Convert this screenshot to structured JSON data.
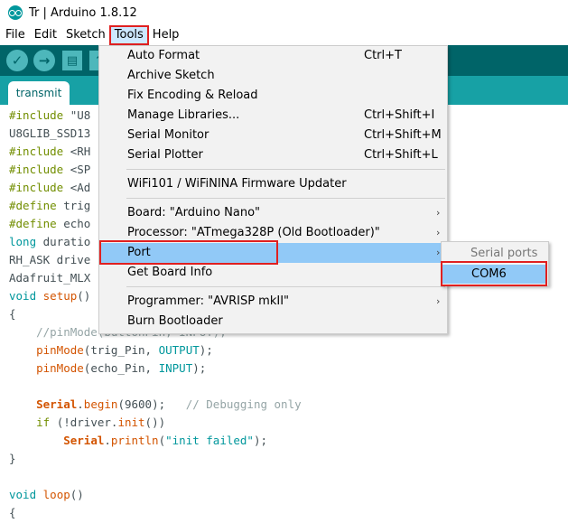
{
  "window": {
    "title": "Tr | Arduino 1.8.12"
  },
  "menubar": {
    "items": [
      "File",
      "Edit",
      "Sketch",
      "Tools",
      "Help"
    ]
  },
  "toolbar": {
    "verify": "✓",
    "upload": "→",
    "new": "▤",
    "open": "↑"
  },
  "tab": {
    "label": "transmit"
  },
  "code": {
    "lines": [
      "#include \"U8",
      "U8GLIB_SSD13",
      "#include <RH",
      "#include <SP",
      "#include <Ad",
      "#define trig",
      "#define echo",
      "long duratio",
      "RH_ASK drive",
      "Adafruit_MLX",
      "void setup()",
      "{",
      "    //pinMode(buttonPin, INPUT);",
      "    pinMode(trig_Pin, OUTPUT);",
      "    pinMode(echo_Pin, INPUT);",
      "",
      "    Serial.begin(9600);   // Debugging only",
      "    if (!driver.init())",
      "        Serial.println(\"init failed\");",
      "}",
      "",
      "void loop()",
      "{"
    ]
  },
  "tools_menu": {
    "items": [
      {
        "label": "Auto Format",
        "shortcut": "Ctrl+T"
      },
      {
        "label": "Archive Sketch",
        "shortcut": ""
      },
      {
        "label": "Fix Encoding & Reload",
        "shortcut": ""
      },
      {
        "label": "Manage Libraries...",
        "shortcut": "Ctrl+Shift+I"
      },
      {
        "label": "Serial Monitor",
        "shortcut": "Ctrl+Shift+M"
      },
      {
        "label": "Serial Plotter",
        "shortcut": "Ctrl+Shift+L"
      },
      {
        "label": "WiFi101 / WiFiNINA Firmware Updater",
        "shortcut": ""
      },
      {
        "label": "Board: \"Arduino Nano\"",
        "shortcut": "",
        "submenu": true
      },
      {
        "label": "Processor: \"ATmega328P (Old Bootloader)\"",
        "shortcut": "",
        "submenu": true
      },
      {
        "label": "Port",
        "shortcut": "",
        "submenu": true,
        "highlighted": true
      },
      {
        "label": "Get Board Info",
        "shortcut": ""
      },
      {
        "label": "Programmer: \"AVRISP mkII\"",
        "shortcut": "",
        "submenu": true
      },
      {
        "label": "Burn Bootloader",
        "shortcut": ""
      }
    ]
  },
  "port_submenu": {
    "header": "Serial ports",
    "items": [
      "COM6"
    ]
  },
  "colors": {
    "toolbar": "#006468",
    "tabstrip": "#17a1a5",
    "highlight": "#91c9f7",
    "annotation": "#e02020"
  }
}
